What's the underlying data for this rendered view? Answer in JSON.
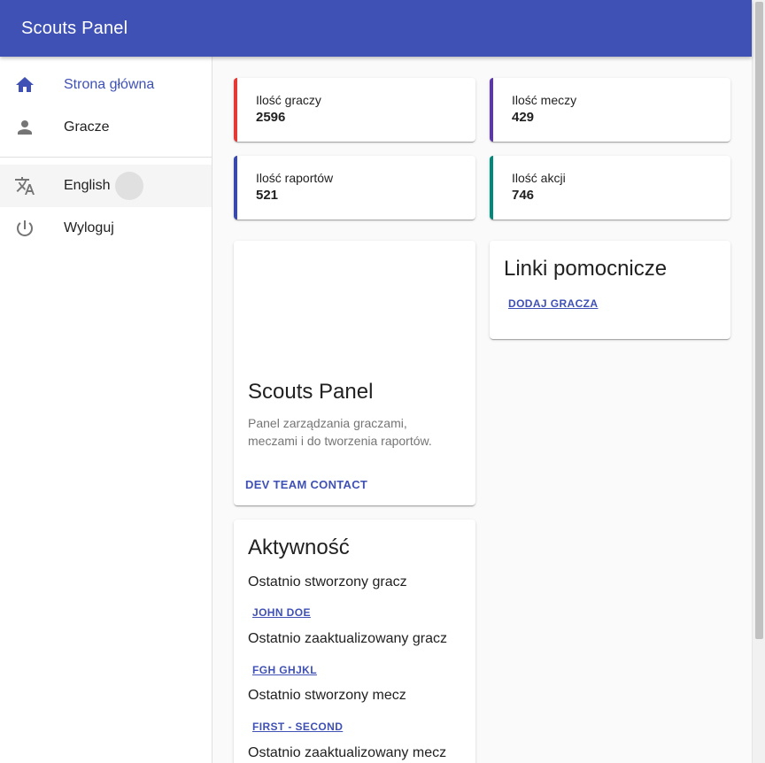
{
  "appbar": {
    "title": "Scouts Panel"
  },
  "sidebar": {
    "items": [
      {
        "label": "Strona główna",
        "icon": "home-icon"
      },
      {
        "label": "Gracze",
        "icon": "person-icon"
      }
    ],
    "secondary": [
      {
        "label": "English",
        "icon": "translate-icon"
      },
      {
        "label": "Wyloguj",
        "icon": "power-icon"
      }
    ]
  },
  "stats": [
    {
      "label": "Ilość graczy",
      "value": "2596",
      "color": "#e53935"
    },
    {
      "label": "Ilość meczy",
      "value": "429",
      "color": "#5e35b1"
    },
    {
      "label": "Ilość raportów",
      "value": "521",
      "color": "#3949ab"
    },
    {
      "label": "Ilość akcji",
      "value": "746",
      "color": "#00897b"
    }
  ],
  "about": {
    "title": "Scouts Panel",
    "description": "Panel zarządzania graczami, meczami i do tworzenia raportów.",
    "action": "Dev team contact"
  },
  "links": {
    "title": "Linki pomocnicze",
    "items": [
      "Dodaj gracza"
    ]
  },
  "activity": {
    "title": "Aktywność",
    "entries": [
      {
        "label": "Ostatnio stworzony gracz",
        "link": "John Doe"
      },
      {
        "label": "Ostatnio zaaktualizowany gracz",
        "link": "fgh ghjkl"
      },
      {
        "label": "Ostatnio stworzony mecz",
        "link": "First - Second"
      },
      {
        "label": "Ostatnio zaaktualizowany mecz"
      }
    ]
  },
  "colors": {
    "primary": "#3f51b5",
    "accent_text": "#3f51b5"
  }
}
